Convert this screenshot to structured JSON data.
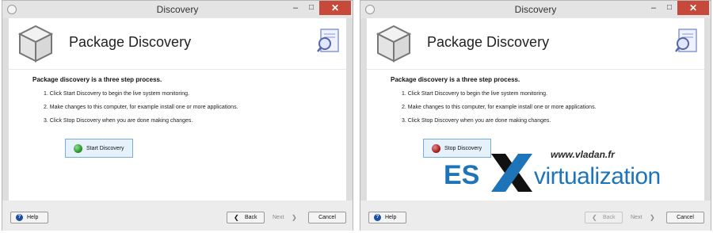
{
  "windows": [
    {
      "title": "Discovery",
      "heading": "Package Discovery",
      "intro": "Package discovery is a three step process.",
      "steps": [
        "1.  Click Start Discovery to begin the live system monitoring.",
        "2.  Make changes to this computer, for example install one or more applications.",
        "3.  Click Stop Discovery when you are done making changes."
      ],
      "action_button": "Start Discovery",
      "action_icon": "green-dot-icon",
      "buttons": {
        "help": "Help",
        "back": "Back",
        "next": "Next",
        "cancel": "Cancel"
      }
    },
    {
      "title": "Discovery",
      "heading": "Package Discovery",
      "intro": "Package discovery is a three step process.",
      "steps": [
        "1.  Click Start Discovery to begin the live system monitoring.",
        "2.  Make changes to this computer, for example install one or more applications.",
        "3.  Click Stop Discovery when you are done making changes."
      ],
      "action_button": "Stop Discovery",
      "action_icon": "red-dot-icon",
      "buttons": {
        "help": "Help",
        "back": "Back",
        "next": "Next",
        "cancel": "Cancel"
      }
    }
  ],
  "watermark": {
    "url": "www.vladan.fr",
    "brand_es": "ES",
    "brand_rest": "virtualization"
  },
  "colors": {
    "close_button": "#c7493a",
    "brand_blue": "#1e74b8",
    "start_dot": "#1f8a1f",
    "stop_dot": "#a01010"
  }
}
